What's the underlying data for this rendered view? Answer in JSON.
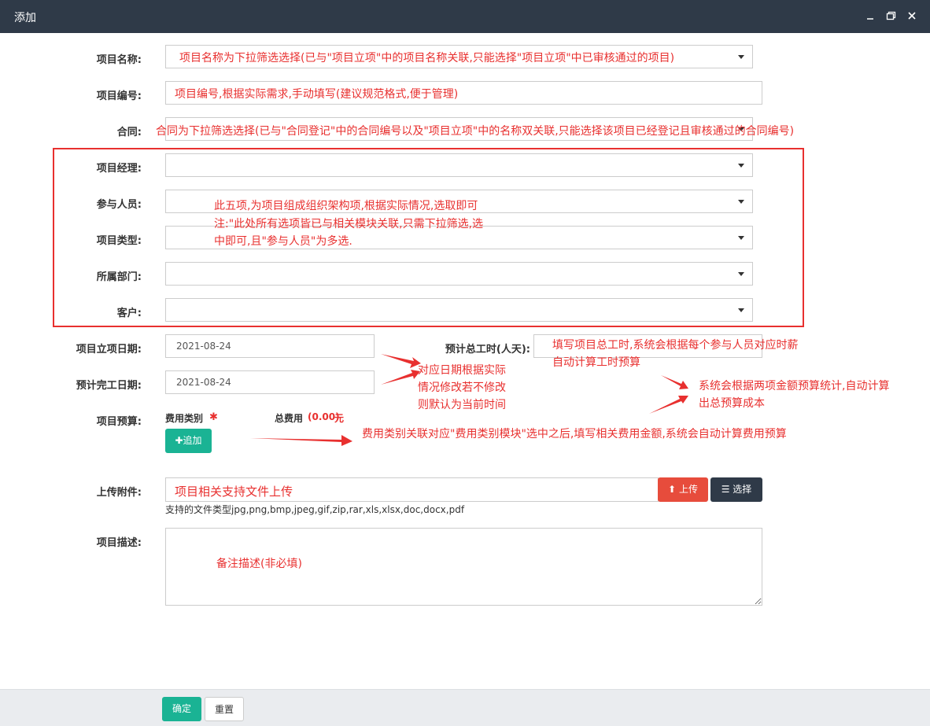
{
  "window": {
    "title": "添加"
  },
  "form": {
    "project_name": {
      "label": "项目名称:"
    },
    "project_no": {
      "label": "项目编号:"
    },
    "contract": {
      "label": "合同:"
    },
    "manager": {
      "label": "项目经理:"
    },
    "members": {
      "label": "参与人员:"
    },
    "type": {
      "label": "项目类型:"
    },
    "dept": {
      "label": "所属部门:"
    },
    "customer": {
      "label": "客户:"
    },
    "start_date": {
      "label": "项目立项日期:",
      "value": "2021-08-24"
    },
    "end_date": {
      "label": "预计完工日期:",
      "value": "2021-08-24"
    },
    "total_hours": {
      "label": "预计总工时(人天):"
    },
    "budget": {
      "label": "项目预算:",
      "category_label": "费用类别",
      "required_mark": "✱",
      "total_label": "总费用",
      "total_value": "(0.00)",
      "total_unit": "元",
      "add_button": "追加"
    },
    "attachment": {
      "label": "上传附件:",
      "upload_button": "上传",
      "choose_button": "选择",
      "hint": "支持的文件类型jpg,png,bmp,jpeg,gif,zip,rar,xls,xlsx,doc,docx,pdf"
    },
    "description": {
      "label": "项目描述:"
    }
  },
  "footer": {
    "confirm": "确定",
    "reset": "重置"
  },
  "annotations": {
    "name": "项目名称为下拉筛选选择(已与\"项目立项\"中的项目名称关联,只能选择\"项目立项\"中已审核通过的项目)",
    "number": "项目编号,根据实际需求,手动填写(建议规范格式,便于管理)",
    "contract": "合同为下拉筛选选择(已与\"合同登记\"中的合同编号以及\"项目立项\"中的名称双关联,只能选择该项目已经登记且审核通过的合同编号)",
    "five_line1": "此五项,为项目组成组织架构项,根据实际情况,选取即可",
    "five_line2": "注:\"此处所有选项皆已与相关模块关联,只需下拉筛选,选",
    "five_line3": "中即可,且\"参与人员\"为多选.",
    "hours_line1": "填写项目总工时,系统会根据每个参与人员对应时薪",
    "hours_line2": "自动计算工时预算",
    "date_line1": "对应日期根据实际",
    "date_line2": "情况修改若不修改",
    "date_line3": "则默认为当前时间",
    "budget_line1": "系统会根据两项金额预算统计,自动计算",
    "budget_line2": "出总预算成本",
    "category": "费用类别关联对应\"费用类别模块\"选中之后,填写相关费用金额,系统会自动计算费用预算",
    "attachment": "项目相关支持文件上传",
    "description": "备注描述(非必填)"
  },
  "colors": {
    "annotation": "#e8302f",
    "titlebar": "#2f3a48",
    "primary": "#1ab394",
    "danger": "#e74c3c",
    "dark": "#2f3a48"
  }
}
